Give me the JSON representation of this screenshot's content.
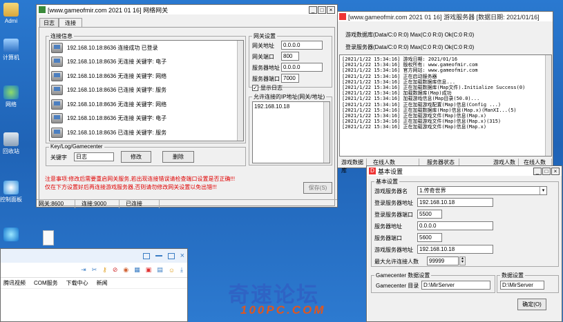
{
  "desktop": {
    "icons": [
      {
        "label": "Admi"
      },
      {
        "label": "计算机"
      },
      {
        "label": "网络"
      },
      {
        "label": "回收站"
      },
      {
        "label": "控制面板"
      },
      {
        "label": ""
      }
    ],
    "watermark_line1": "奇速论坛",
    "watermark_line2": "100PC.COM"
  },
  "left_window": {
    "title": "[www.gameofmir.com 2021 01 16] 网络网关",
    "tabs": [
      "日志",
      "连接"
    ],
    "list_group_label": "连接信息",
    "rows": [
      "192.168.10.18:8636 连接成功 已登录",
      "192.168.10.18:8636 无连接 关键字: 电子",
      "192.168.10.18:8636 无连接 关键字: 网络",
      "192.168.10.18:8636 已连接 关键字: 服务",
      "192.168.10.18:8636 无连接 关键字: 网络",
      "192.168.10.18:8636 无连接 关键字: 电子",
      "192.168.10.18:8636 已连接 关键字: 服务"
    ],
    "gw_group_label": "网关设置",
    "gw_fields": [
      {
        "label": "网关地址",
        "value": "0.0.0.0"
      },
      {
        "label": "网关端口",
        "value": "800"
      },
      {
        "label": "服务器地址",
        "value": "0.0.0.0"
      },
      {
        "label": "服务器端口",
        "value": "7000"
      }
    ],
    "checkbox_label": "显示日志",
    "ip_group_label": "允许连接的IP地址(网关/地址)",
    "ip_value": "192.168.10.18",
    "bottom_group_label": "Key/Log/Gamecenter",
    "keyword_label": "关键字",
    "keyword_value": "日志",
    "btn_modify": "修改",
    "btn_delete": "删除",
    "btn_apply": "保存(S)",
    "warning_line1": "注意事项:修改后需要重启网关服务,若出现连接错误请检查端口设置是否正确!!!",
    "warning_line2": "仅在下方设置好后再连接游戏服务器,否则请勿修改网关设置以免出错!!!",
    "status": [
      "网关:8600",
      "连接:9000",
      "已连接",
      ""
    ]
  },
  "right_window": {
    "title": "[www.gameofmir.com 2021 01 16] 游戏服务器 [数据日期: 2021/01/16]",
    "header_rows": [
      "游戏数据库(Data/C:0 R:0) Max(C:0 R:0) Ok(C:0 R:0)",
      "登录服务器(Data/C:0 R:0) Max(C:0 R:0) Ok(C:0 R:0)"
    ],
    "log_lines": [
      "[2021/1/22 15:34:16] 游戏日期: 2021/01/16",
      "[2021/1/22 15:34:16] 版权所有: www.gameofmir.com",
      "[2021/1/22 15:34:16] 官方网站: www.gameofmir.com",
      "[2021/1/22 15:34:16] 正在启动服务器",
      "[2021/1/22 15:34:16] 正在加载数据库信息...",
      "[2021/1/22 15:34:16] 正在加载数据库(Map文件).Initialize Success(0)",
      "[2021/1/22 15:34:16] 加载数据库(Map)成功",
      "[2021/1/22 15:34:16] 加载游戏信息(Map目录(50.0)...",
      "[2021/1/22 15:34:16] 正在加载游戏配置(Map)信息(Config ...)",
      "[2021/1/22 15:34:16] 正在加载数据库(Map)信息(Map.x)(ManXI...(5)",
      "[2021/1/22 15:34:16] 正在加载游戏文件(Map)信息(Map.x)",
      "[2021/1/22 15:34:16] 正在加载游戏文件(Map)信息(Map.x)(315)",
      "[2021/1/22 15:34:16] 正在加载游戏文件(Map)信息(Map.x)"
    ],
    "status": [
      "游戏数据库",
      "在线人数",
      "服务器状态",
      "游戏人数",
      "在线人数"
    ]
  },
  "settings_window": {
    "title": "基本设置",
    "group_label": "基本设置",
    "fields": [
      {
        "label": "游戏服务器名",
        "value": "1.传奇世界"
      },
      {
        "label": "登录服务器地址",
        "value": "192.168.10.18"
      },
      {
        "label": "登录服务器端口",
        "value": "5500"
      },
      {
        "label": "服务器地址",
        "value": "0.0.0.0"
      },
      {
        "label": "服务器端口",
        "value": "5600"
      },
      {
        "label": "游戏服务器地址",
        "value": "192.168.10.18"
      },
      {
        "label": "最大允许连接人数",
        "value": "99999"
      }
    ],
    "bottom_left_label": "Gamecenter 数据设置",
    "bottom_left_field_label": "Gamecenter 目录",
    "bottom_left_value": "D:\\MirServer",
    "bottom_right_label": "数据设置",
    "bottom_right_value": "D:\\MirServer",
    "btn_ok": "确定(O)"
  },
  "browser": {
    "toolbar_icons": [
      "window-icon",
      "minimize-icon",
      "restore-icon",
      "close-icon"
    ],
    "bookmarks": [
      "腾讯视频",
      "COM服务",
      "下载中心",
      "新闻"
    ]
  }
}
